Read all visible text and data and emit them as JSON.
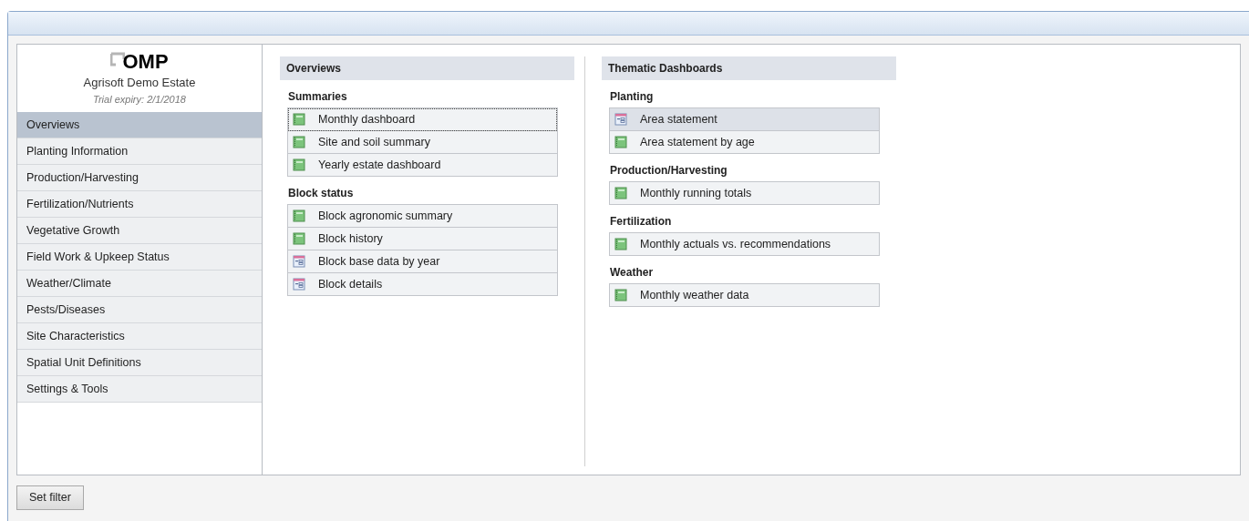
{
  "logo": {
    "text": "OMP"
  },
  "estate": {
    "name": "Agrisoft Demo Estate",
    "expiry": "Trial expiry: 2/1/2018"
  },
  "sidebar": {
    "items": [
      {
        "label": "Overviews",
        "selected": true
      },
      {
        "label": "Planting Information",
        "selected": false
      },
      {
        "label": "Production/Harvesting",
        "selected": false
      },
      {
        "label": "Fertilization/Nutrients",
        "selected": false
      },
      {
        "label": "Vegetative Growth",
        "selected": false
      },
      {
        "label": "Field Work & Upkeep Status",
        "selected": false
      },
      {
        "label": "Weather/Climate",
        "selected": false
      },
      {
        "label": "Pests/Diseases",
        "selected": false
      },
      {
        "label": "Site Characteristics",
        "selected": false
      },
      {
        "label": "Spatial Unit Definitions",
        "selected": false
      },
      {
        "label": "Settings & Tools",
        "selected": false
      }
    ]
  },
  "panels": [
    {
      "title": "Overviews",
      "groups": [
        {
          "title": "Summaries",
          "items": [
            {
              "label": "Monthly dashboard",
              "kind": "report",
              "focused": true,
              "highlighted": false
            },
            {
              "label": "Site and soil summary",
              "kind": "report",
              "focused": false,
              "highlighted": false
            },
            {
              "label": "Yearly estate dashboard",
              "kind": "report",
              "focused": false,
              "highlighted": false
            }
          ]
        },
        {
          "title": "Block status",
          "items": [
            {
              "label": "Block agronomic summary",
              "kind": "report",
              "focused": false,
              "highlighted": false
            },
            {
              "label": "Block history",
              "kind": "report",
              "focused": false,
              "highlighted": false
            },
            {
              "label": "Block base data by year",
              "kind": "form",
              "focused": false,
              "highlighted": false
            },
            {
              "label": "Block details",
              "kind": "form",
              "focused": false,
              "highlighted": false
            }
          ]
        }
      ]
    },
    {
      "title": "Thematic Dashboards",
      "groups": [
        {
          "title": "Planting",
          "items": [
            {
              "label": "Area statement",
              "kind": "form",
              "focused": false,
              "highlighted": true
            },
            {
              "label": "Area statement by age",
              "kind": "report",
              "focused": false,
              "highlighted": false
            }
          ]
        },
        {
          "title": "Production/Harvesting",
          "items": [
            {
              "label": "Monthly running totals",
              "kind": "report",
              "focused": false,
              "highlighted": false
            }
          ]
        },
        {
          "title": "Fertilization",
          "items": [
            {
              "label": "Monthly actuals vs. recommendations",
              "kind": "report",
              "focused": false,
              "highlighted": false
            }
          ]
        },
        {
          "title": "Weather",
          "items": [
            {
              "label": "Monthly weather data",
              "kind": "report",
              "focused": false,
              "highlighted": false
            }
          ]
        }
      ]
    }
  ],
  "footer": {
    "button": "Set filter"
  }
}
